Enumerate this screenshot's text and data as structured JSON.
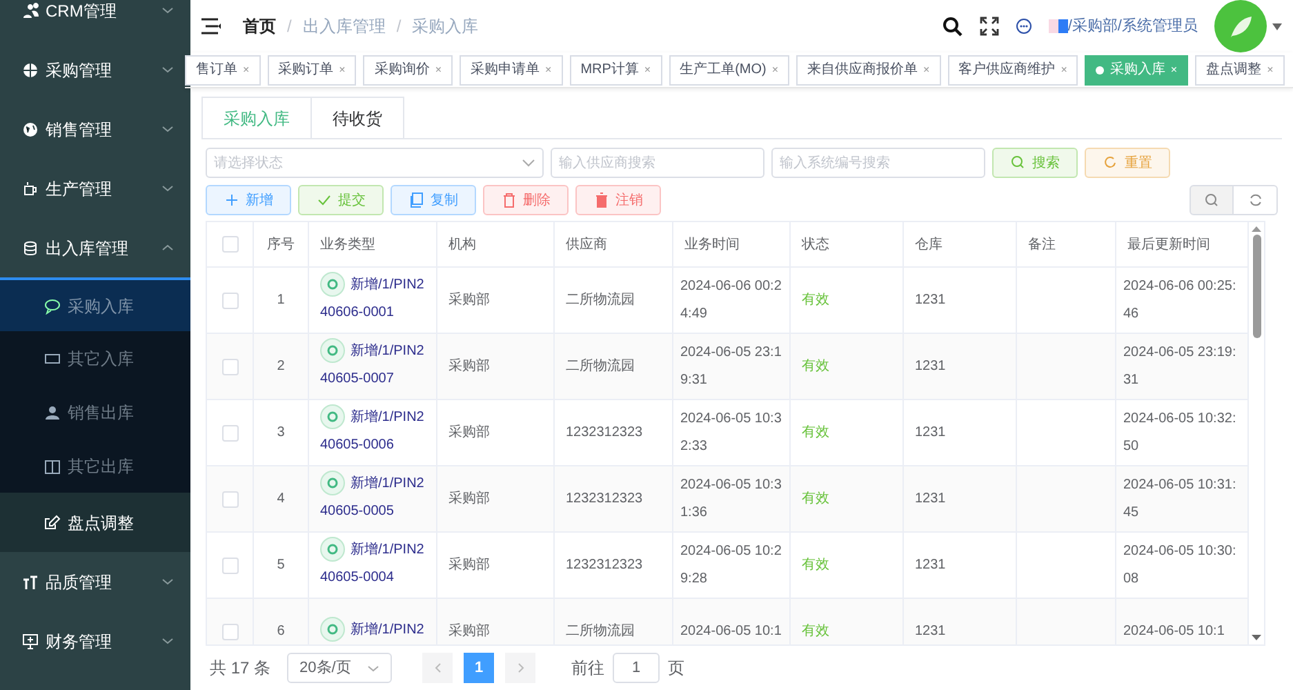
{
  "sidebar": {
    "items": [
      {
        "label": "CRM管理",
        "expanded": false
      },
      {
        "label": "采购管理",
        "expanded": false
      },
      {
        "label": "销售管理",
        "expanded": false
      },
      {
        "label": "生产管理",
        "expanded": false
      },
      {
        "label": "出入库管理",
        "expanded": true,
        "children": [
          {
            "label": "采购入库",
            "selected": true
          },
          {
            "label": "其它入库",
            "selected": false
          },
          {
            "label": "销售出库",
            "selected": false
          },
          {
            "label": "其它出库",
            "selected": false
          },
          {
            "label": "盘点调整",
            "selected": false
          }
        ]
      },
      {
        "label": "品质管理",
        "expanded": false
      },
      {
        "label": "财务管理",
        "expanded": false
      }
    ]
  },
  "header": {
    "breadcrumbs": [
      "首页",
      "出入库管理",
      "采购入库"
    ],
    "separator": "/",
    "user": "/采购部/系统管理员"
  },
  "tags": [
    {
      "label": "售订单",
      "selected": false
    },
    {
      "label": "采购订单",
      "selected": false
    },
    {
      "label": "采购询价",
      "selected": false
    },
    {
      "label": "采购申请单",
      "selected": false
    },
    {
      "label": "MRP计算",
      "selected": false
    },
    {
      "label": "生产工单(MO)",
      "selected": false
    },
    {
      "label": "来自供应商报价单",
      "selected": false
    },
    {
      "label": "客户供应商维护",
      "selected": false
    },
    {
      "label": "采购入库",
      "selected": true
    },
    {
      "label": "盘点调整",
      "selected": false
    }
  ],
  "tag_close": "×",
  "tabs": [
    {
      "label": "采购入库",
      "selected": true
    },
    {
      "label": "待收货",
      "selected": false
    }
  ],
  "filters": {
    "status_placeholder": "请选择状态",
    "supplier_placeholder": "输入供应商搜索",
    "number_placeholder": "输入系统编号搜索",
    "search": "搜索",
    "reset": "重置"
  },
  "actions": [
    {
      "label": "新增",
      "kind": "add"
    },
    {
      "label": "提交",
      "kind": "submit"
    },
    {
      "label": "复制",
      "kind": "copy"
    },
    {
      "label": "删除",
      "kind": "delete"
    },
    {
      "label": "注销",
      "kind": "cancel"
    }
  ],
  "table": {
    "select_all": false,
    "columns": [
      "序号",
      "业务类型",
      "机构",
      "供应商",
      "业务时间",
      "状态",
      "仓库",
      "备注",
      "最后更新时间"
    ],
    "rows": [
      {
        "checked": false,
        "cells": [
          "1",
          "新增/1/PIN240606-0001",
          "采购部",
          "二所物流园",
          "2024-06-06 00:24:49",
          "有效",
          "1231",
          "",
          "2024-06-06 00:25:46"
        ]
      },
      {
        "checked": false,
        "cells": [
          "2",
          "新增/1/PIN240605-0007",
          "采购部",
          "二所物流园",
          "2024-06-05 23:19:31",
          "有效",
          "1231",
          "",
          "2024-06-05 23:19:31"
        ]
      },
      {
        "checked": false,
        "cells": [
          "3",
          "新增/1/PIN240605-0006",
          "采购部",
          "1232312323",
          "2024-06-05 10:32:33",
          "有效",
          "1231",
          "",
          "2024-06-05 10:32:50"
        ]
      },
      {
        "checked": false,
        "cells": [
          "4",
          "新增/1/PIN240605-0005",
          "采购部",
          "1232312323",
          "2024-06-05 10:31:36",
          "有效",
          "1231",
          "",
          "2024-06-05 10:31:45"
        ]
      },
      {
        "checked": false,
        "cells": [
          "5",
          "新增/1/PIN240605-0004",
          "采购部",
          "1232312323",
          "2024-06-05 10:29:28",
          "有效",
          "1231",
          "",
          "2024-06-05 10:30:08"
        ]
      },
      {
        "checked": false,
        "cells": [
          "6",
          "新增/1/PIN2",
          "采购部",
          "二所物流园",
          "2024-06-05 10:1",
          "有效",
          "1231",
          "",
          "2024-06-05 10:1"
        ]
      }
    ]
  },
  "pagination": {
    "total": "共 17 条",
    "page_size": "20条/页",
    "pages": [
      {
        "label": "1",
        "selected": true
      }
    ],
    "goto": "前往",
    "goto_value": "1",
    "page_unit": "页"
  }
}
